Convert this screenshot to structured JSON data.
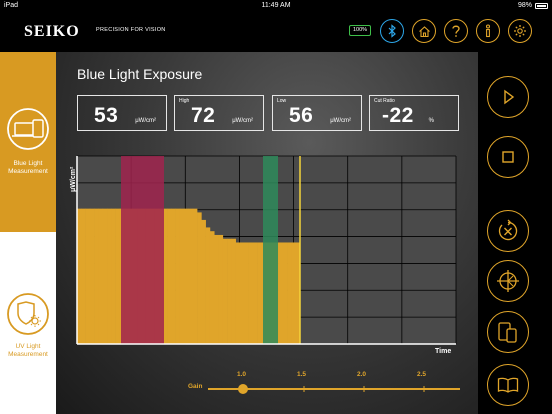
{
  "status_bar": {
    "device": "iPad",
    "time": "11:49 AM",
    "battery": "98%"
  },
  "header": {
    "logo": "SEIKO",
    "tagline": "PRECISION FOR VISION",
    "battery_badge": "100%",
    "accent_color": "#e0a52a",
    "bluetooth_color": "#2da6e8",
    "icons": [
      "bluetooth-icon",
      "home-icon",
      "help-icon",
      "info-icon",
      "settings-icon"
    ]
  },
  "sidebar": {
    "items": [
      {
        "label": "Blue Light\nMeasurement",
        "icon": "blue-light-device-icon",
        "active": true
      },
      {
        "label": "UV Light\nMeasurement",
        "icon": "uv-shield-icon",
        "active": false
      }
    ]
  },
  "main": {
    "title": "Blue Light Exposure",
    "metrics": [
      {
        "label": "",
        "value": "53",
        "unit": "μW/cm²"
      },
      {
        "label": "High",
        "value": "72",
        "unit": "μW/cm²"
      },
      {
        "label": "Low",
        "value": "56",
        "unit": "μW/cm²"
      },
      {
        "label": "Cut Ratio",
        "value": "-22",
        "unit": "%"
      }
    ]
  },
  "chart_data": {
    "type": "area",
    "ylabel": "μW/cm²",
    "xlabel": "Time",
    "grid": true,
    "series_color": "#e0a52a",
    "y_values": [
      72,
      72,
      72,
      72,
      72,
      72,
      72,
      72,
      72,
      72,
      72,
      72,
      72,
      72,
      72,
      72,
      72,
      72,
      72,
      72,
      72,
      72,
      72,
      72,
      72,
      72,
      72,
      72,
      70,
      66,
      62,
      60,
      58,
      58,
      56,
      56,
      56,
      54,
      54,
      54,
      54,
      54,
      54,
      54,
      54,
      54,
      54,
      54,
      54,
      54,
      54,
      54
    ],
    "ylim": [
      0,
      100
    ],
    "highlight_bands": [
      {
        "name": "high",
        "color": "#a0234e"
      },
      {
        "name": "low",
        "color": "#2e8a5a"
      }
    ]
  },
  "gain": {
    "label": "Gain",
    "ticks": [
      "1.0",
      "1.5",
      "2.0",
      "2.5"
    ],
    "value": "1.0"
  },
  "controls": [
    {
      "name": "play-button",
      "icon": "play-icon"
    },
    {
      "name": "stop-button",
      "icon": "stop-icon"
    },
    {
      "name": "reset-button",
      "icon": "reset-icon"
    },
    {
      "name": "target-button",
      "icon": "crosshair-icon"
    },
    {
      "name": "device-button",
      "icon": "devices-icon"
    },
    {
      "name": "guide-button",
      "icon": "book-icon"
    }
  ]
}
